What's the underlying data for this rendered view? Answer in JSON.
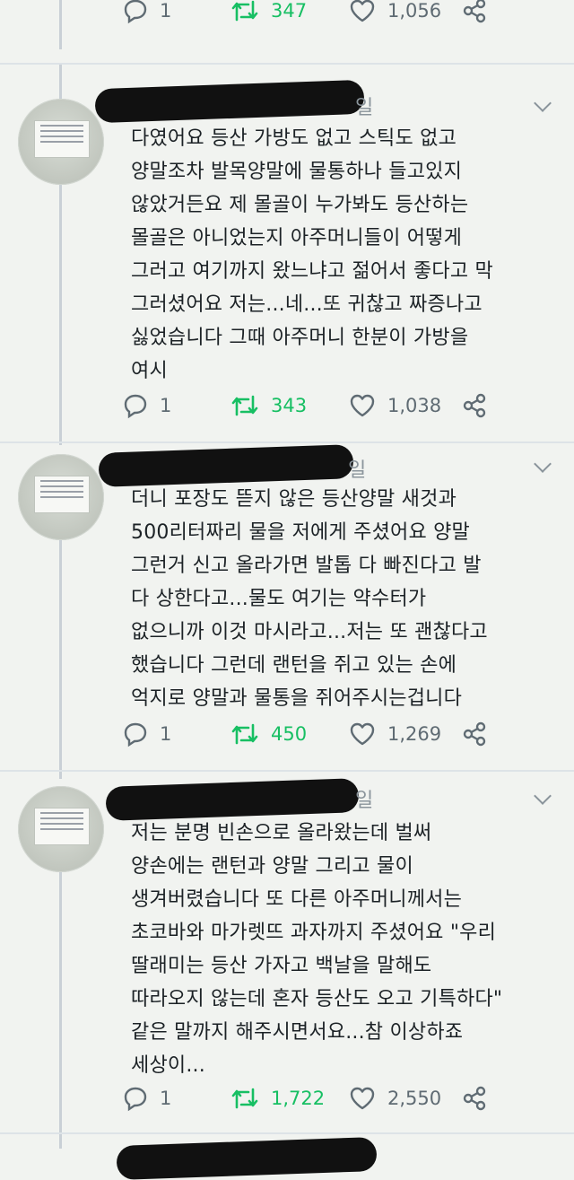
{
  "top_partial": {
    "replies": "1",
    "retweets": "347",
    "likes": "1,056"
  },
  "tweets": [
    {
      "date_fragment": "일",
      "text": "다였어요 등산 가방도 없고 스틱도 없고\n양말조차 발목양말에 물통하나 들고있지\n않았거든요 제 몰골이 누가봐도 등산하는\n몰골은 아니었는지 아주머니들이 어떻게\n그러고 여기까지 왔느냐고 젊어서 좋다고 막\n그러셨어요 저는...네...또 귀찮고 짜증나고\n싫었습니다 그때 아주머니 한분이 가방을\n여시",
      "replies": "1",
      "retweets": "343",
      "likes": "1,038"
    },
    {
      "date_fragment": "일",
      "text": "더니 포장도 뜯지 않은 등산양말 새것과\n500리터짜리 물을 저에게 주셨어요 양말\n그런거 신고 올라가면 발톱 다 빠진다고 발\n다 상한다고...물도 여기는 약수터가\n없으니까 이것 마시라고...저는 또 괜찮다고\n했습니다 그런데 랜턴을 쥐고 있는 손에\n억지로 양말과 물통을 쥐어주시는겁니다",
      "replies": "1",
      "retweets": "450",
      "likes": "1,269"
    },
    {
      "date_fragment": "일",
      "text": "저는 분명 빈손으로 올라왔는데 벌써\n양손에는 랜턴과 양말 그리고 물이\n생겨버렸습니다 또 다른 아주머니께서는\n초코바와 마가렛뜨 과자까지 주셨어요 \"우리\n딸래미는 등산 가자고 백날을 말해도\n따라오지 않는데 혼자 등산도 오고 기특하다\"\n같은 말까지 해주시면서요...참 이상하죠\n세상이...",
      "replies": "1",
      "retweets": "1,722",
      "likes": "2,550"
    }
  ],
  "colors": {
    "retweet": "#17bf63",
    "icon": "#5f6b73",
    "background": "#f1f3f0"
  },
  "icons": [
    "reply-icon",
    "retweet-icon",
    "heart-icon",
    "share-icon",
    "chevron-down-icon"
  ]
}
